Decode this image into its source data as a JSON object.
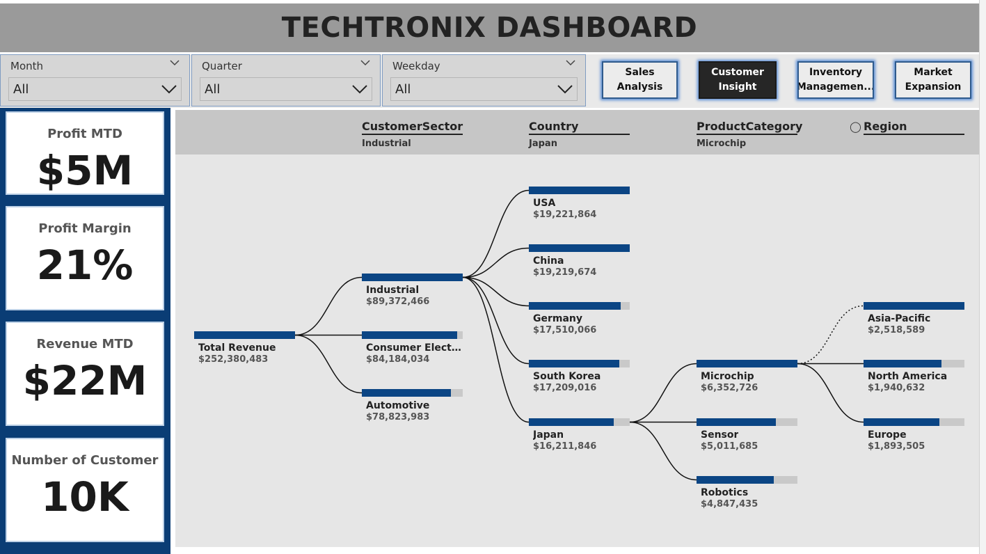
{
  "title": "TECHTRONIX DASHBOARD",
  "slicers": [
    {
      "label": "Month",
      "value": "All"
    },
    {
      "label": "Quarter",
      "value": "All"
    },
    {
      "label": "Weekday",
      "value": "All"
    }
  ],
  "nav_buttons": [
    {
      "label": "Sales Analysis",
      "active": false
    },
    {
      "label": "Customer\nInsight",
      "active": true
    },
    {
      "label": "Inventory\nManagemen...",
      "active": false
    },
    {
      "label": "Market\nExpansion",
      "active": false
    }
  ],
  "kpis": [
    {
      "label": "Profit MTD",
      "value": "$5M"
    },
    {
      "label": "Profit Margin",
      "value": "21%"
    },
    {
      "label": "Revenue MTD",
      "value": "$22M"
    },
    {
      "label": "Number of Customer",
      "value": "10K"
    }
  ],
  "decomposition_tree": {
    "levels": [
      {
        "name": "CustomerSector",
        "selected": "Industrial"
      },
      {
        "name": "Country",
        "selected": "Japan"
      },
      {
        "name": "ProductCategory",
        "selected": "Microchip"
      },
      {
        "name": "Region",
        "selected": "",
        "ai_split": true
      }
    ],
    "root": {
      "label": "Total Revenue",
      "value": "$252,380,483",
      "fraction": 1.0
    },
    "sector_nodes": [
      {
        "label": "Industrial",
        "value": "$89,372,466",
        "fraction": 1.0
      },
      {
        "label": "Consumer Electro...",
        "value": "$84,184,034",
        "fraction": 0.942
      },
      {
        "label": "Automotive",
        "value": "$78,823,983",
        "fraction": 0.882
      }
    ],
    "country_nodes": [
      {
        "label": "USA",
        "value": "$19,221,864",
        "fraction": 1.0
      },
      {
        "label": "China",
        "value": "$19,219,674",
        "fraction": 1.0
      },
      {
        "label": "Germany",
        "value": "$17,510,066",
        "fraction": 0.911
      },
      {
        "label": "South Korea",
        "value": "$17,209,016",
        "fraction": 0.895
      },
      {
        "label": "Japan",
        "value": "$16,211,846",
        "fraction": 0.843
      }
    ],
    "category_nodes": [
      {
        "label": "Microchip",
        "value": "$6,352,726",
        "fraction": 1.0
      },
      {
        "label": "Sensor",
        "value": "$5,011,685",
        "fraction": 0.789
      },
      {
        "label": "Robotics",
        "value": "$4,847,435",
        "fraction": 0.763
      }
    ],
    "region_nodes": [
      {
        "label": "Asia-Pacific",
        "value": "$2,518,589",
        "fraction": 1.0
      },
      {
        "label": "North America",
        "value": "$1,940,632",
        "fraction": 0.771
      },
      {
        "label": "Europe",
        "value": "$1,893,505",
        "fraction": 0.752
      }
    ]
  },
  "colors": {
    "bar": "#0b4584",
    "bar_bg": "#c9c9c9",
    "kpi_frame": "#0a3d75",
    "active_button": "#262626"
  }
}
